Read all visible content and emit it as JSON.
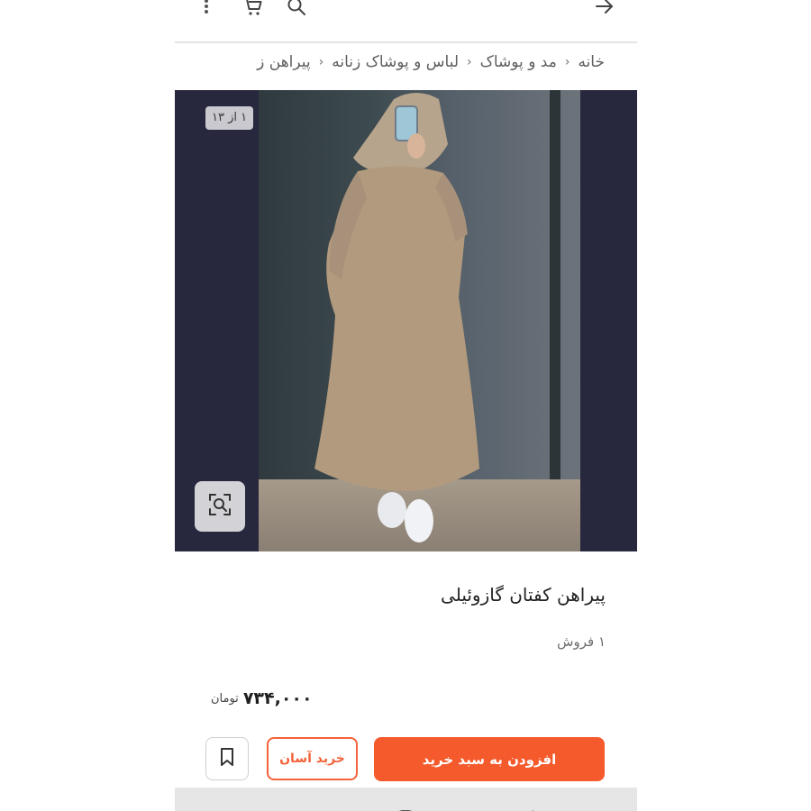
{
  "topbar": {
    "icons": [
      "more-icon",
      "cart-icon",
      "search-icon",
      "back-arrow-icon"
    ]
  },
  "breadcrumb": {
    "items": [
      "خانه",
      "مد و پوشاک",
      "لباس و پوشاک زنانه",
      "پیراهن ز"
    ],
    "separator": "‹"
  },
  "gallery": {
    "counter": "۱ از ۱۳",
    "zoom_icon": "image-search-icon"
  },
  "product": {
    "title": "پیراهن کفتان گازوئیلی",
    "sales": "۱ فروش",
    "price": "۷۳۴,۰۰۰",
    "currency": "تومان"
  },
  "actions": {
    "add_to_cart": "افزودن به سبد خرید",
    "easy_buy": "خرید آسان",
    "bookmark_icon": "bookmark-icon"
  },
  "colors": {
    "accent": "#f55a2c",
    "accent_outline": "#f3623a",
    "photo_bg": "#27273e"
  }
}
